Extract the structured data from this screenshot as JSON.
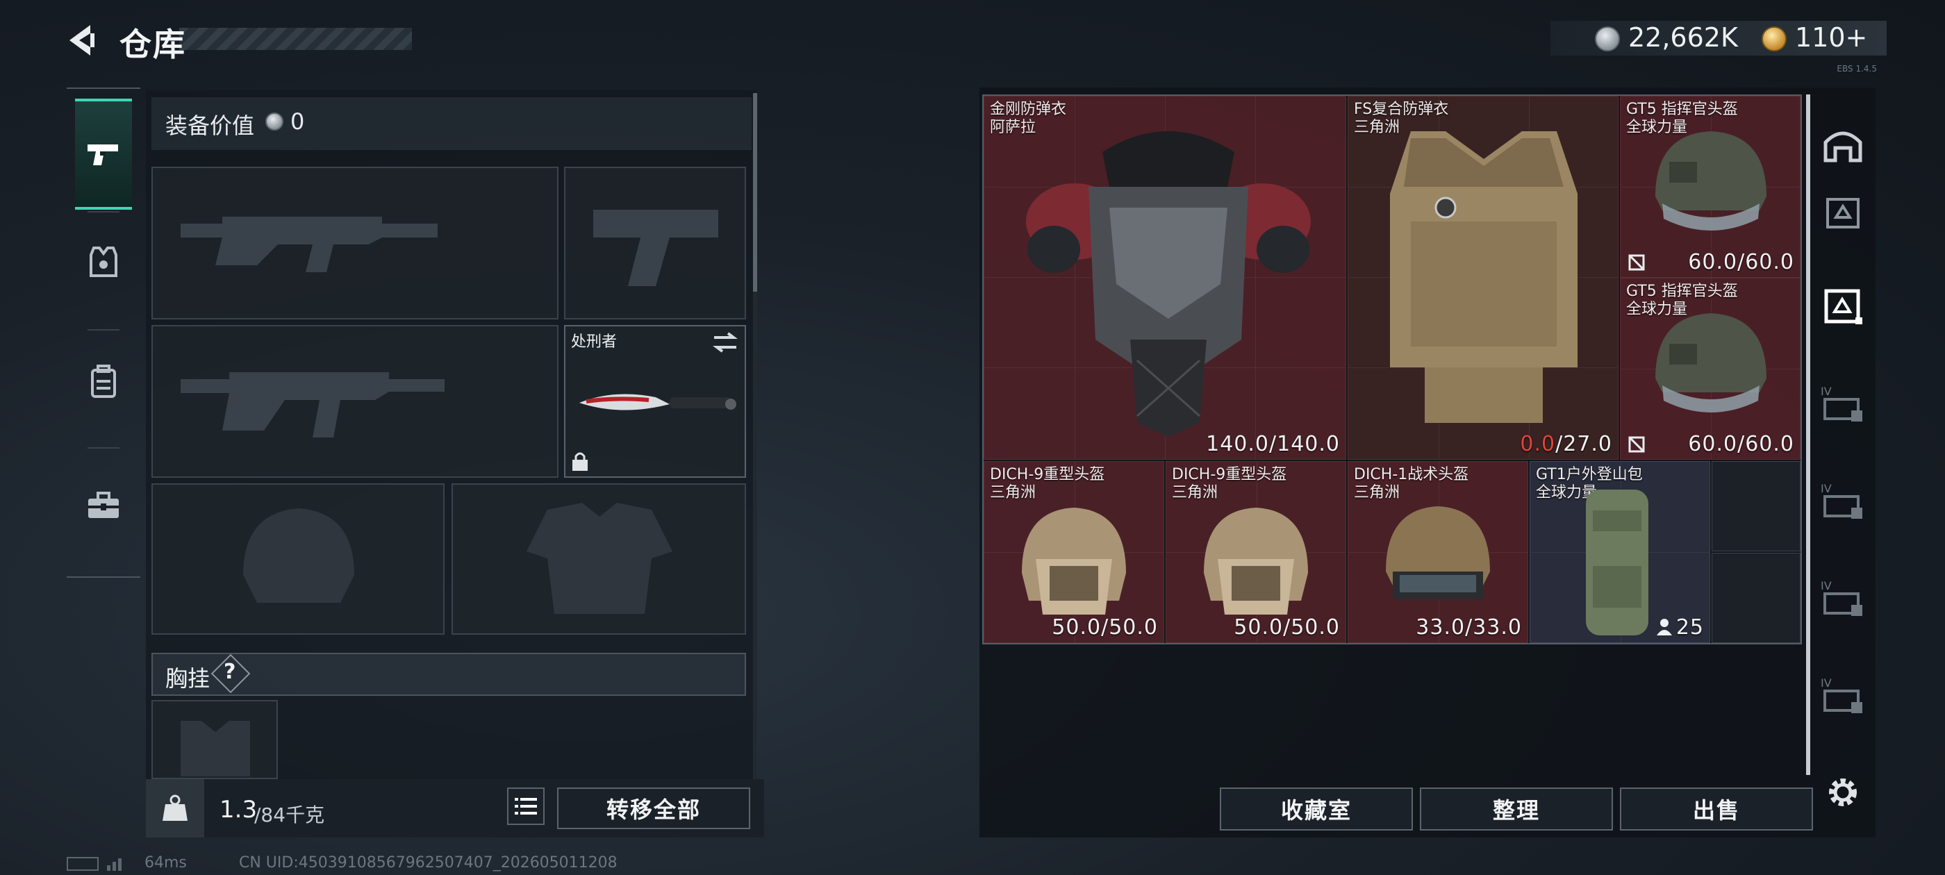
{
  "header": {
    "title": "仓库",
    "currency_silver": "22,662K",
    "currency_gold": "110+",
    "build_version": "EBS 1.4.5"
  },
  "categories": [
    {
      "icon": "pistol-icon",
      "active": true
    },
    {
      "icon": "armor-vest-icon",
      "active": false
    },
    {
      "icon": "backpack-icon",
      "active": false
    },
    {
      "icon": "toolbox-icon",
      "active": false
    }
  ],
  "equipment": {
    "value_label": "装备价值",
    "value": "0",
    "melee_name": "处刑者",
    "chest_rig_label": "胸挂",
    "help_glyph": "?",
    "weight_current": "1.3",
    "weight_max": "/84千克",
    "transfer_all": "转移全部"
  },
  "inventory": {
    "items": [
      {
        "name": "金刚防弹衣",
        "sub": "阿萨拉",
        "durability": "140.0/140.0",
        "color": "#6e262e"
      },
      {
        "name": "FS复合防弹衣",
        "sub": "三角洲",
        "durability_red": "0.0",
        "durability": "/27.0",
        "color": "#4a3a32"
      },
      {
        "name": "GT5 指挥官头盔",
        "sub": "全球力量",
        "durability": "60.0/60.0"
      },
      {
        "name": "GT5 指挥官头盔",
        "sub": "全球力量",
        "durability": "60.0/60.0"
      },
      {
        "name": "DICH-9重型头盔",
        "sub": "三角洲",
        "durability": "50.0/50.0"
      },
      {
        "name": "DICH-9重型头盔",
        "sub": "三角洲",
        "durability": "50.0/50.0"
      },
      {
        "name": "DICH-1战术头盔",
        "sub": "三角洲",
        "durability": "33.0/33.0"
      },
      {
        "name": "GT1户外登山包",
        "sub": "全球力量",
        "count": "25"
      }
    ],
    "buttons": {
      "collection": "收藏室",
      "sort": "整理",
      "sell": "出售"
    }
  },
  "status": {
    "ping": "64ms",
    "uid": "CN UID:450391085679625074​07_202605011208"
  }
}
